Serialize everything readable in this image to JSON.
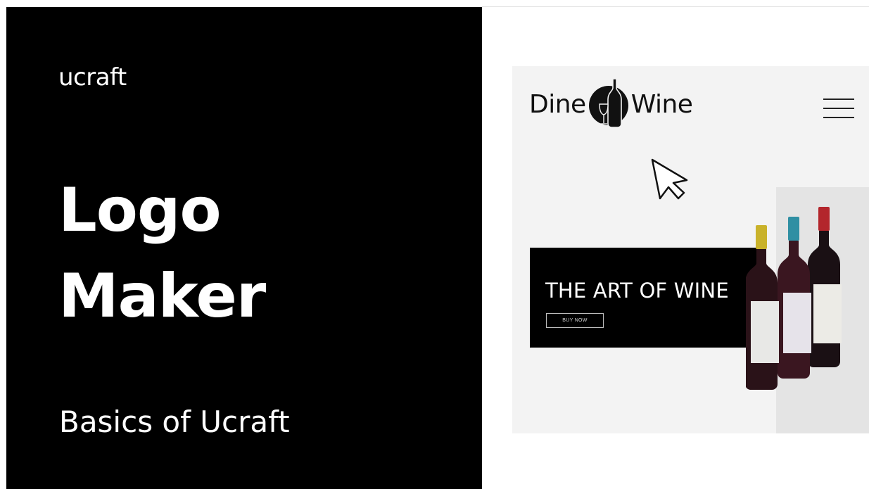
{
  "left_panel": {
    "brand": "ucraft",
    "title_line1": "Logo",
    "title_line2": "Maker",
    "subtitle": "Basics of Ucraft",
    "background": "#000000",
    "text_color": "#ffffff"
  },
  "preview": {
    "logo": {
      "word_left": "Dine",
      "word_right": "Wine",
      "emblem_icon": "wine-bottle-glass-emblem-icon"
    },
    "menu_icon": "hamburger-menu-icon",
    "cursor_icon": "mouse-pointer-icon",
    "hero": {
      "title": "THE ART OF WINE",
      "button_label": "BUY NOW"
    },
    "bottles": [
      {
        "cap_color": "#c9b22a"
      },
      {
        "cap_color": "#2f8fa3"
      },
      {
        "cap_color": "#b3262c"
      }
    ],
    "colors": {
      "mock_bg": "#f3f3f3",
      "hero_bg": "#000000",
      "side_block": "#e4e4e4"
    }
  }
}
